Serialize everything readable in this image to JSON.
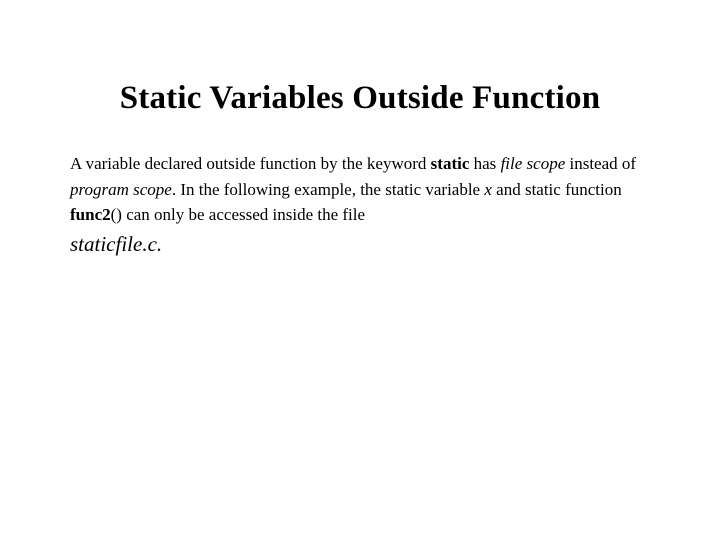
{
  "title": "Static Variables Outside Function",
  "p": {
    "t1": "A variable declared outside function by the keyword ",
    "kw_static": "static",
    "t2": " has ",
    "file_scope": "file scope",
    "t3": " instead of ",
    "program_scope": "program scope",
    "t4": ". In the following example, the static variable ",
    "var_x": "x",
    "t5": " and static function ",
    "func2": "func2",
    "t6": "() can only be accessed inside the file"
  },
  "filename": "staticfile.c."
}
